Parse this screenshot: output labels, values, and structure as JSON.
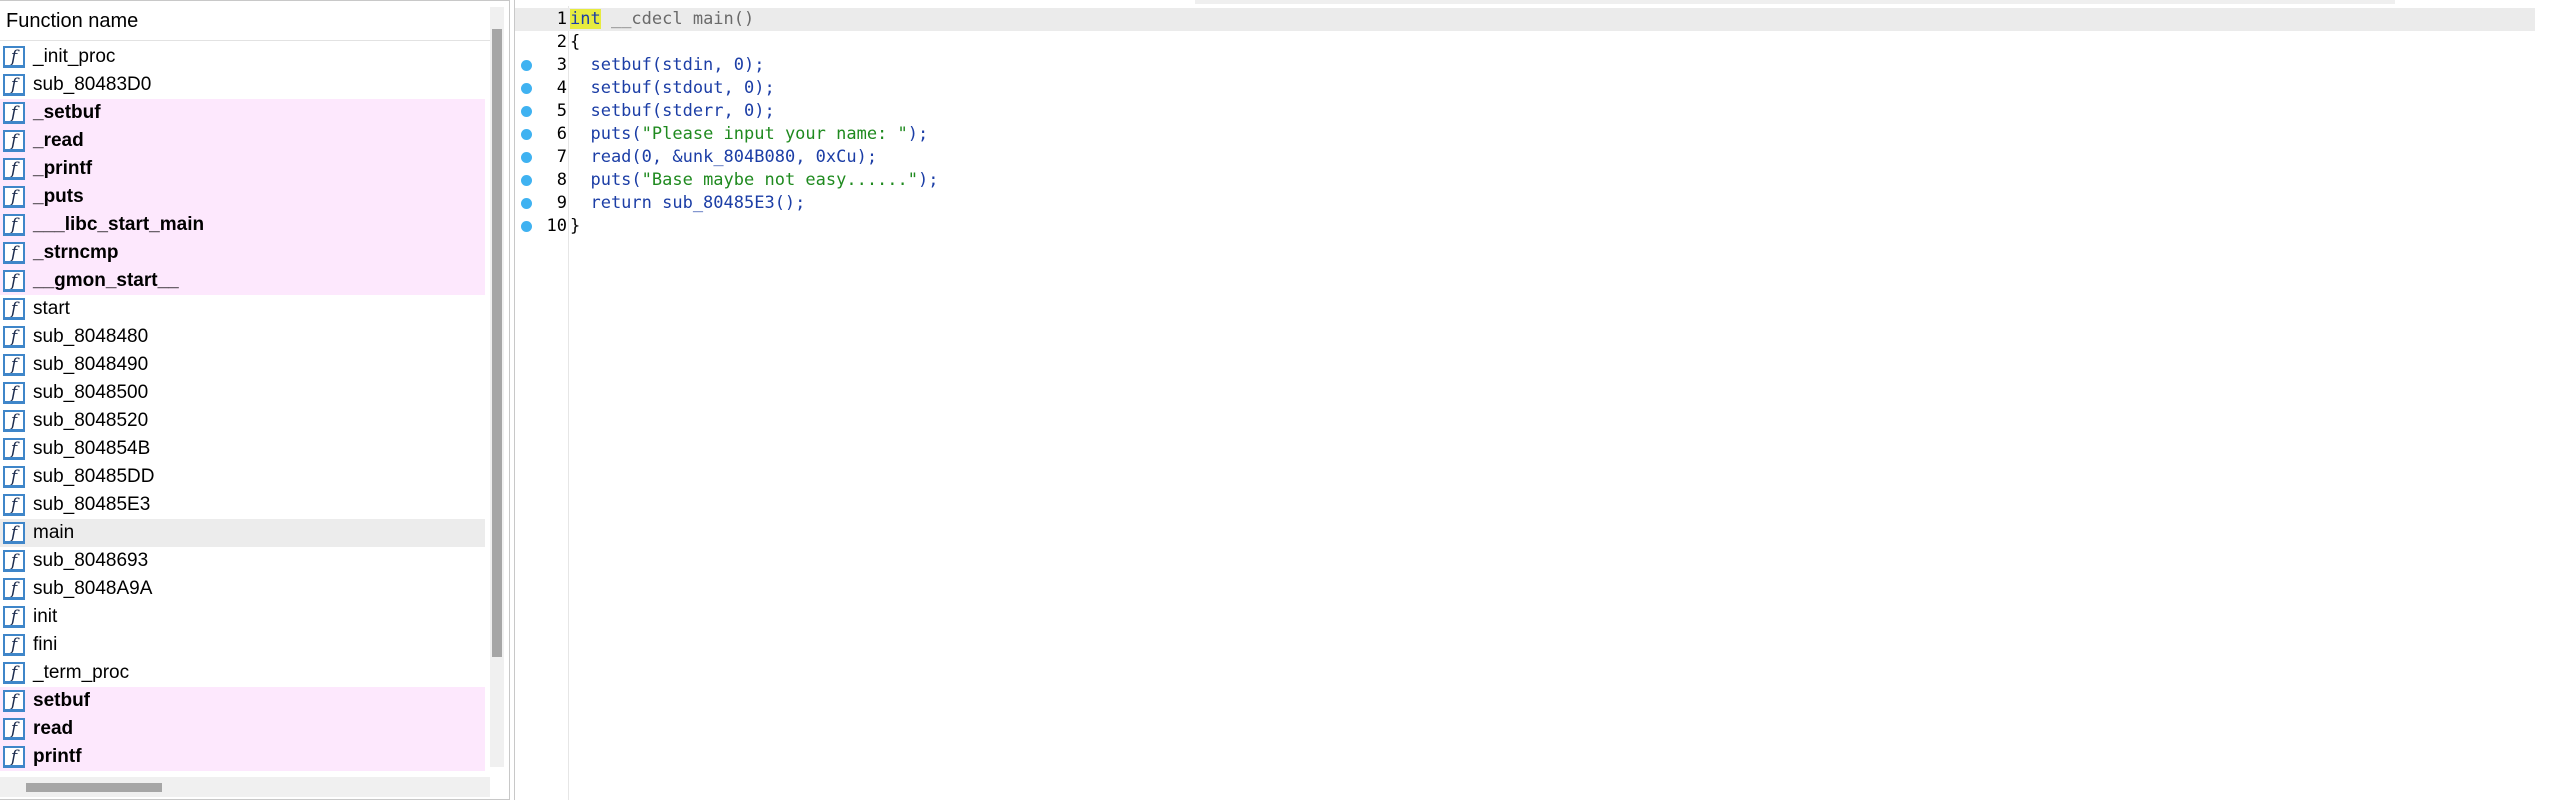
{
  "function_panel": {
    "header": "Function name",
    "icon_glyph": "f",
    "icon_name": "function-icon",
    "items": [
      {
        "name": "_init_proc",
        "library": false
      },
      {
        "name": "sub_80483D0",
        "library": false
      },
      {
        "name": "_setbuf",
        "library": true
      },
      {
        "name": "_read",
        "library": true
      },
      {
        "name": "_printf",
        "library": true
      },
      {
        "name": "_puts",
        "library": true
      },
      {
        "name": "___libc_start_main",
        "library": true
      },
      {
        "name": "_strncmp",
        "library": true
      },
      {
        "name": "__gmon_start__",
        "library": true
      },
      {
        "name": "start",
        "library": false
      },
      {
        "name": "sub_8048480",
        "library": false
      },
      {
        "name": "sub_8048490",
        "library": false
      },
      {
        "name": "sub_8048500",
        "library": false
      },
      {
        "name": "sub_8048520",
        "library": false
      },
      {
        "name": "sub_804854B",
        "library": false
      },
      {
        "name": "sub_80485DD",
        "library": false
      },
      {
        "name": "sub_80485E3",
        "library": false
      },
      {
        "name": "main",
        "library": false,
        "selected": true
      },
      {
        "name": "sub_8048693",
        "library": false
      },
      {
        "name": "sub_8048A9A",
        "library": false
      },
      {
        "name": "init",
        "library": false
      },
      {
        "name": "fini",
        "library": false
      },
      {
        "name": "_term_proc",
        "library": false
      },
      {
        "name": "setbuf",
        "library": true
      },
      {
        "name": "read",
        "library": true
      },
      {
        "name": "printf",
        "library": true
      }
    ]
  },
  "pseudocode": {
    "lines": [
      {
        "num": "1",
        "bp": false,
        "tokens": [
          [
            "int",
            "hl"
          ],
          [
            " __cdecl main()",
            "gray"
          ]
        ]
      },
      {
        "num": "2",
        "bp": false,
        "tokens": [
          [
            "{",
            "black"
          ]
        ]
      },
      {
        "num": "3",
        "bp": true,
        "tokens": [
          [
            "  setbuf(stdin, ",
            "blue"
          ],
          [
            "0",
            "num"
          ],
          [
            ");",
            "blue"
          ]
        ]
      },
      {
        "num": "4",
        "bp": true,
        "tokens": [
          [
            "  setbuf(stdout, ",
            "blue"
          ],
          [
            "0",
            "num"
          ],
          [
            ");",
            "blue"
          ]
        ]
      },
      {
        "num": "5",
        "bp": true,
        "tokens": [
          [
            "  setbuf(stderr, ",
            "blue"
          ],
          [
            "0",
            "num"
          ],
          [
            ");",
            "blue"
          ]
        ]
      },
      {
        "num": "6",
        "bp": true,
        "tokens": [
          [
            "  puts(",
            "blue"
          ],
          [
            "\"Please input your name: \"",
            "str"
          ],
          [
            ");",
            "blue"
          ]
        ]
      },
      {
        "num": "7",
        "bp": true,
        "tokens": [
          [
            "  read(",
            "blue"
          ],
          [
            "0",
            "num"
          ],
          [
            ", &unk_804B080, ",
            "blue"
          ],
          [
            "0xCu",
            "num"
          ],
          [
            ");",
            "blue"
          ]
        ]
      },
      {
        "num": "8",
        "bp": true,
        "tokens": [
          [
            "  puts(",
            "blue"
          ],
          [
            "\"Base maybe not easy......\"",
            "str"
          ],
          [
            ");",
            "blue"
          ]
        ]
      },
      {
        "num": "9",
        "bp": true,
        "tokens": [
          [
            "  return sub_80485E3();",
            "blue"
          ]
        ]
      },
      {
        "num": "10",
        "bp": true,
        "tokens": [
          [
            "}",
            "black"
          ]
        ]
      }
    ]
  },
  "colors": {
    "library_row_bg": "#fde8fd",
    "selected_row_bg": "#ececec",
    "breakpoint": "#3fb2f1",
    "keyword_highlight": "#e7eb3f",
    "code_blue": "#1c3ea6",
    "string_green": "#1f8a1f"
  }
}
